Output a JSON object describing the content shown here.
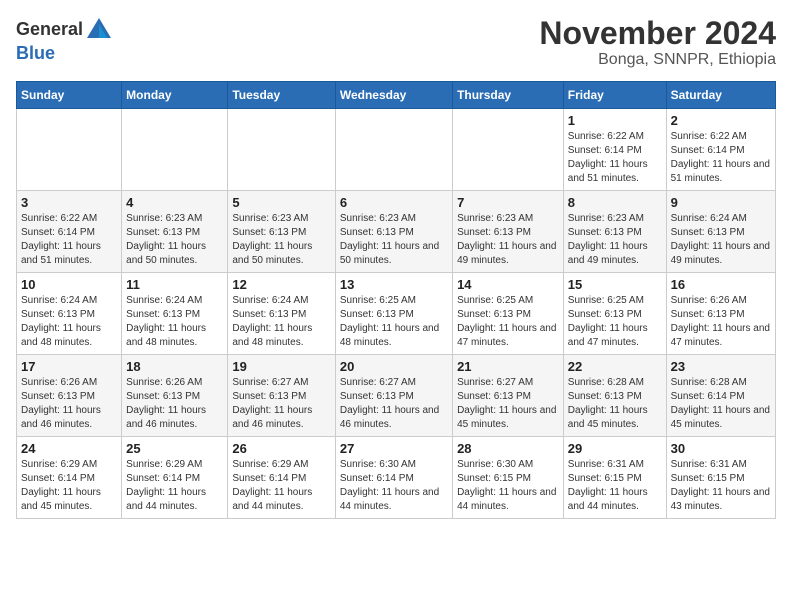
{
  "header": {
    "logo_general": "General",
    "logo_blue": "Blue",
    "month_title": "November 2024",
    "subtitle": "Bonga, SNNPR, Ethiopia"
  },
  "days_of_week": [
    "Sunday",
    "Monday",
    "Tuesday",
    "Wednesday",
    "Thursday",
    "Friday",
    "Saturday"
  ],
  "weeks": [
    [
      {
        "day": "",
        "info": ""
      },
      {
        "day": "",
        "info": ""
      },
      {
        "day": "",
        "info": ""
      },
      {
        "day": "",
        "info": ""
      },
      {
        "day": "",
        "info": ""
      },
      {
        "day": "1",
        "info": "Sunrise: 6:22 AM\nSunset: 6:14 PM\nDaylight: 11 hours and 51 minutes."
      },
      {
        "day": "2",
        "info": "Sunrise: 6:22 AM\nSunset: 6:14 PM\nDaylight: 11 hours and 51 minutes."
      }
    ],
    [
      {
        "day": "3",
        "info": "Sunrise: 6:22 AM\nSunset: 6:14 PM\nDaylight: 11 hours and 51 minutes."
      },
      {
        "day": "4",
        "info": "Sunrise: 6:23 AM\nSunset: 6:13 PM\nDaylight: 11 hours and 50 minutes."
      },
      {
        "day": "5",
        "info": "Sunrise: 6:23 AM\nSunset: 6:13 PM\nDaylight: 11 hours and 50 minutes."
      },
      {
        "day": "6",
        "info": "Sunrise: 6:23 AM\nSunset: 6:13 PM\nDaylight: 11 hours and 50 minutes."
      },
      {
        "day": "7",
        "info": "Sunrise: 6:23 AM\nSunset: 6:13 PM\nDaylight: 11 hours and 49 minutes."
      },
      {
        "day": "8",
        "info": "Sunrise: 6:23 AM\nSunset: 6:13 PM\nDaylight: 11 hours and 49 minutes."
      },
      {
        "day": "9",
        "info": "Sunrise: 6:24 AM\nSunset: 6:13 PM\nDaylight: 11 hours and 49 minutes."
      }
    ],
    [
      {
        "day": "10",
        "info": "Sunrise: 6:24 AM\nSunset: 6:13 PM\nDaylight: 11 hours and 48 minutes."
      },
      {
        "day": "11",
        "info": "Sunrise: 6:24 AM\nSunset: 6:13 PM\nDaylight: 11 hours and 48 minutes."
      },
      {
        "day": "12",
        "info": "Sunrise: 6:24 AM\nSunset: 6:13 PM\nDaylight: 11 hours and 48 minutes."
      },
      {
        "day": "13",
        "info": "Sunrise: 6:25 AM\nSunset: 6:13 PM\nDaylight: 11 hours and 48 minutes."
      },
      {
        "day": "14",
        "info": "Sunrise: 6:25 AM\nSunset: 6:13 PM\nDaylight: 11 hours and 47 minutes."
      },
      {
        "day": "15",
        "info": "Sunrise: 6:25 AM\nSunset: 6:13 PM\nDaylight: 11 hours and 47 minutes."
      },
      {
        "day": "16",
        "info": "Sunrise: 6:26 AM\nSunset: 6:13 PM\nDaylight: 11 hours and 47 minutes."
      }
    ],
    [
      {
        "day": "17",
        "info": "Sunrise: 6:26 AM\nSunset: 6:13 PM\nDaylight: 11 hours and 46 minutes."
      },
      {
        "day": "18",
        "info": "Sunrise: 6:26 AM\nSunset: 6:13 PM\nDaylight: 11 hours and 46 minutes."
      },
      {
        "day": "19",
        "info": "Sunrise: 6:27 AM\nSunset: 6:13 PM\nDaylight: 11 hours and 46 minutes."
      },
      {
        "day": "20",
        "info": "Sunrise: 6:27 AM\nSunset: 6:13 PM\nDaylight: 11 hours and 46 minutes."
      },
      {
        "day": "21",
        "info": "Sunrise: 6:27 AM\nSunset: 6:13 PM\nDaylight: 11 hours and 45 minutes."
      },
      {
        "day": "22",
        "info": "Sunrise: 6:28 AM\nSunset: 6:13 PM\nDaylight: 11 hours and 45 minutes."
      },
      {
        "day": "23",
        "info": "Sunrise: 6:28 AM\nSunset: 6:14 PM\nDaylight: 11 hours and 45 minutes."
      }
    ],
    [
      {
        "day": "24",
        "info": "Sunrise: 6:29 AM\nSunset: 6:14 PM\nDaylight: 11 hours and 45 minutes."
      },
      {
        "day": "25",
        "info": "Sunrise: 6:29 AM\nSunset: 6:14 PM\nDaylight: 11 hours and 44 minutes."
      },
      {
        "day": "26",
        "info": "Sunrise: 6:29 AM\nSunset: 6:14 PM\nDaylight: 11 hours and 44 minutes."
      },
      {
        "day": "27",
        "info": "Sunrise: 6:30 AM\nSunset: 6:14 PM\nDaylight: 11 hours and 44 minutes."
      },
      {
        "day": "28",
        "info": "Sunrise: 6:30 AM\nSunset: 6:15 PM\nDaylight: 11 hours and 44 minutes."
      },
      {
        "day": "29",
        "info": "Sunrise: 6:31 AM\nSunset: 6:15 PM\nDaylight: 11 hours and 44 minutes."
      },
      {
        "day": "30",
        "info": "Sunrise: 6:31 AM\nSunset: 6:15 PM\nDaylight: 11 hours and 43 minutes."
      }
    ]
  ]
}
